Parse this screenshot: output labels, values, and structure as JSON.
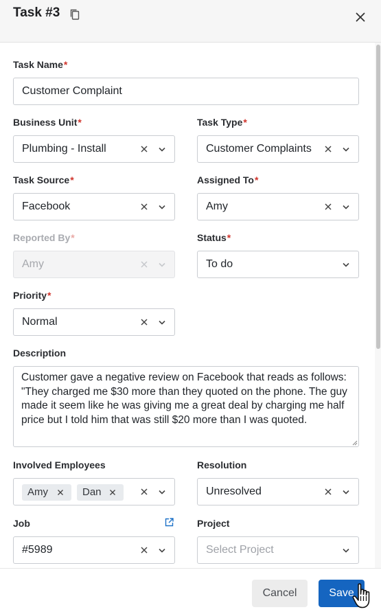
{
  "header": {
    "title": "Task #3"
  },
  "fields": {
    "task_name": {
      "label": "Task Name",
      "required": "*",
      "value": "Customer Complaint"
    },
    "business_unit": {
      "label": "Business Unit",
      "required": "*",
      "value": "Plumbing - Install"
    },
    "task_type": {
      "label": "Task Type",
      "required": "*",
      "value": "Customer Complaints"
    },
    "task_source": {
      "label": "Task Source",
      "required": "*",
      "value": "Facebook"
    },
    "assigned_to": {
      "label": "Assigned To",
      "required": "*",
      "value": "Amy"
    },
    "reported_by": {
      "label": "Reported By",
      "required": "*",
      "value": "Amy"
    },
    "status": {
      "label": "Status",
      "required": "*",
      "value": "To do"
    },
    "priority": {
      "label": "Priority",
      "required": "*",
      "value": "Normal"
    },
    "description": {
      "label": "Description",
      "value": "Customer gave a negative review on Facebook that reads as follows: \"They charged me $30 more than they quoted on the phone. The guy made it seem like he was giving me a great deal by charging me half price but I told him that was still $20 more than I was quoted."
    },
    "involved_employees": {
      "label": "Involved Employees",
      "chips": [
        "Amy",
        "Dan"
      ]
    },
    "resolution": {
      "label": "Resolution",
      "value": "Unresolved"
    },
    "job": {
      "label": "Job",
      "value": "#5989"
    },
    "project": {
      "label": "Project",
      "placeholder": "Select Project"
    }
  },
  "footer": {
    "cancel_label": "Cancel",
    "save_label": "Save"
  },
  "colors": {
    "accent": "#1565c0",
    "required": "#d0342c"
  },
  "icons": [
    "copy-icon",
    "close-icon",
    "clear-icon",
    "chevron-down-icon",
    "external-link-icon",
    "hand-pointer-cursor"
  ]
}
